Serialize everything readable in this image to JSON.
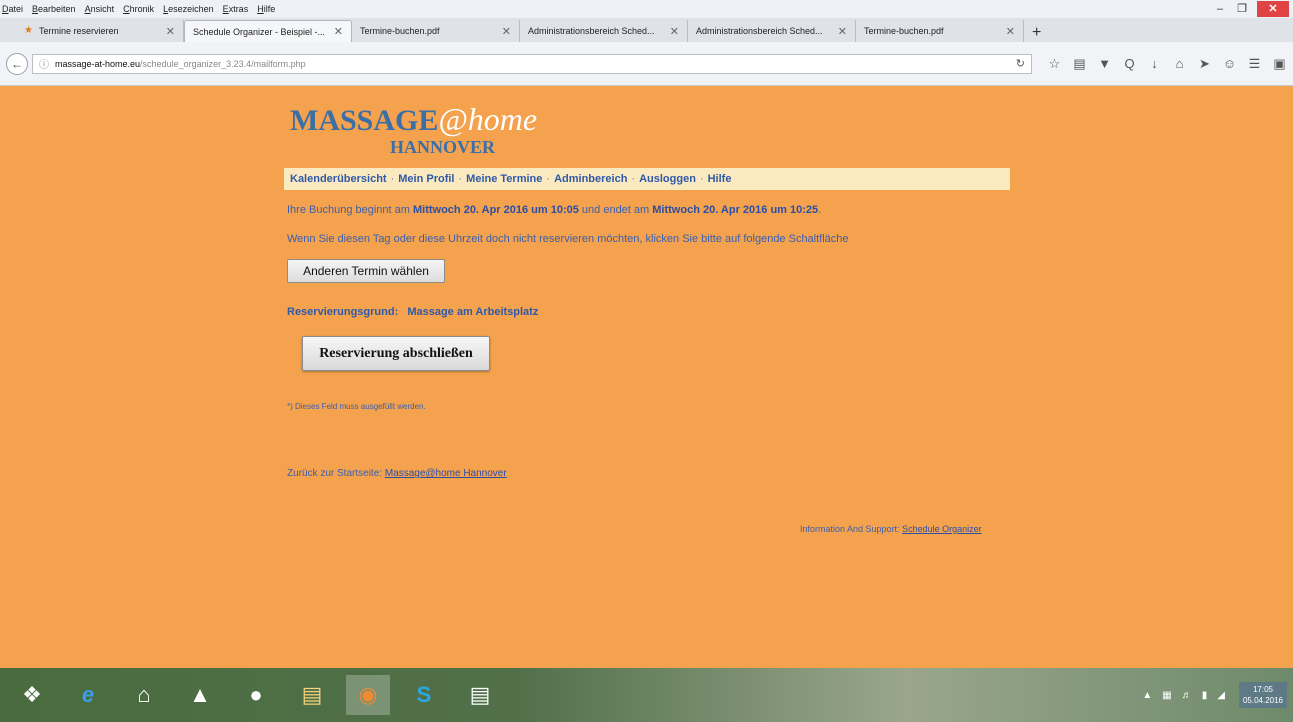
{
  "menu": [
    "Datei",
    "Bearbeiten",
    "Ansicht",
    "Chronik",
    "Lesezeichen",
    "Extras",
    "Hilfe"
  ],
  "tabs": [
    {
      "title": "Termine reservieren",
      "active": false
    },
    {
      "title": "Schedule Organizer - Beispiel -...",
      "active": true
    },
    {
      "title": "Termine-buchen.pdf",
      "active": false
    },
    {
      "title": "Administrationsbereich Sched...",
      "active": false
    },
    {
      "title": "Administrationsbereich Sched...",
      "active": false
    },
    {
      "title": "Termine-buchen.pdf",
      "active": false
    }
  ],
  "url": {
    "host": "massage-at-home.eu",
    "path": "/schedule_organizer_3.23.4/mailform.php"
  },
  "logo": {
    "massage": "MASSAGE",
    "at": "@",
    "home": "home",
    "city": "HANNOVER"
  },
  "nav": [
    "Kalenderübersicht",
    "Mein Profil",
    "Meine Termine",
    "Adminbereich",
    "Ausloggen",
    "Hilfe"
  ],
  "booking": {
    "prefix": "Ihre Buchung beginnt am",
    "start": "Mittwoch 20. Apr 2016 um 10:05",
    "middle": "und endet am",
    "end": "Mittwoch 20. Apr 2016 um 10:25",
    "suffix": "."
  },
  "change_text": "Wenn Sie diesen Tag oder diese Uhrzeit doch nicht reservieren möchten, klicken Sie bitte auf folgende Schaltfläche",
  "other_button": "Anderen Termin wählen",
  "reason": {
    "label": "Reservierungsgrund:",
    "value": "Massage am Arbeitsplatz"
  },
  "submit_button": "Reservierung abschließen",
  "required_note": "*) Dieses Feld muss ausgefüllt werden.",
  "back": {
    "label": "Zurück zur Startseite:",
    "link": "Massage@home Hannover"
  },
  "support": {
    "label": "Information And Support:",
    "link": "Schedule Organizer"
  },
  "clock": {
    "time": "17:05",
    "date": "05.04.2016"
  }
}
